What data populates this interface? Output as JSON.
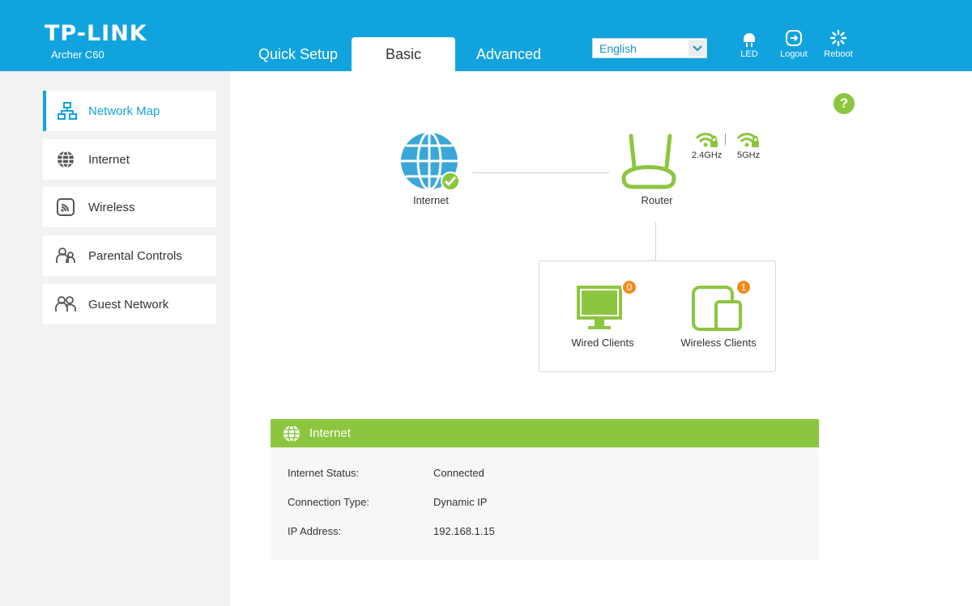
{
  "header": {
    "brand": "TP-LINK",
    "model": "Archer C60",
    "tabs": {
      "quick": "Quick Setup",
      "basic": "Basic",
      "advanced": "Advanced"
    },
    "language": "English",
    "led_label": "LED",
    "logout_label": "Logout",
    "reboot_label": "Reboot"
  },
  "sidebar": {
    "items": [
      {
        "label": "Network Map",
        "icon": "network-map-icon",
        "active": true
      },
      {
        "label": "Internet",
        "icon": "globe-icon"
      },
      {
        "label": "Wireless",
        "icon": "wireless-icon"
      },
      {
        "label": "Parental Controls",
        "icon": "parental-icon"
      },
      {
        "label": "Guest Network",
        "icon": "guest-icon"
      }
    ]
  },
  "map": {
    "internet_label": "Internet",
    "router_label": "Router",
    "band_24": "2.4GHz",
    "band_5": "5GHz",
    "wired_label": "Wired Clients",
    "wired_count": "0",
    "wireless_label": "Wireless Clients",
    "wireless_count": "1"
  },
  "info": {
    "title": "Internet",
    "rows": [
      {
        "label": "Internet Status:",
        "value": "Connected"
      },
      {
        "label": "Connection Type:",
        "value": "Dynamic IP"
      },
      {
        "label": "IP Address:",
        "value": "192.168.1.15"
      }
    ]
  },
  "colors": {
    "brand_blue": "#11a3dd",
    "green": "#8cc63f",
    "badge_orange": "#f28a1c"
  }
}
